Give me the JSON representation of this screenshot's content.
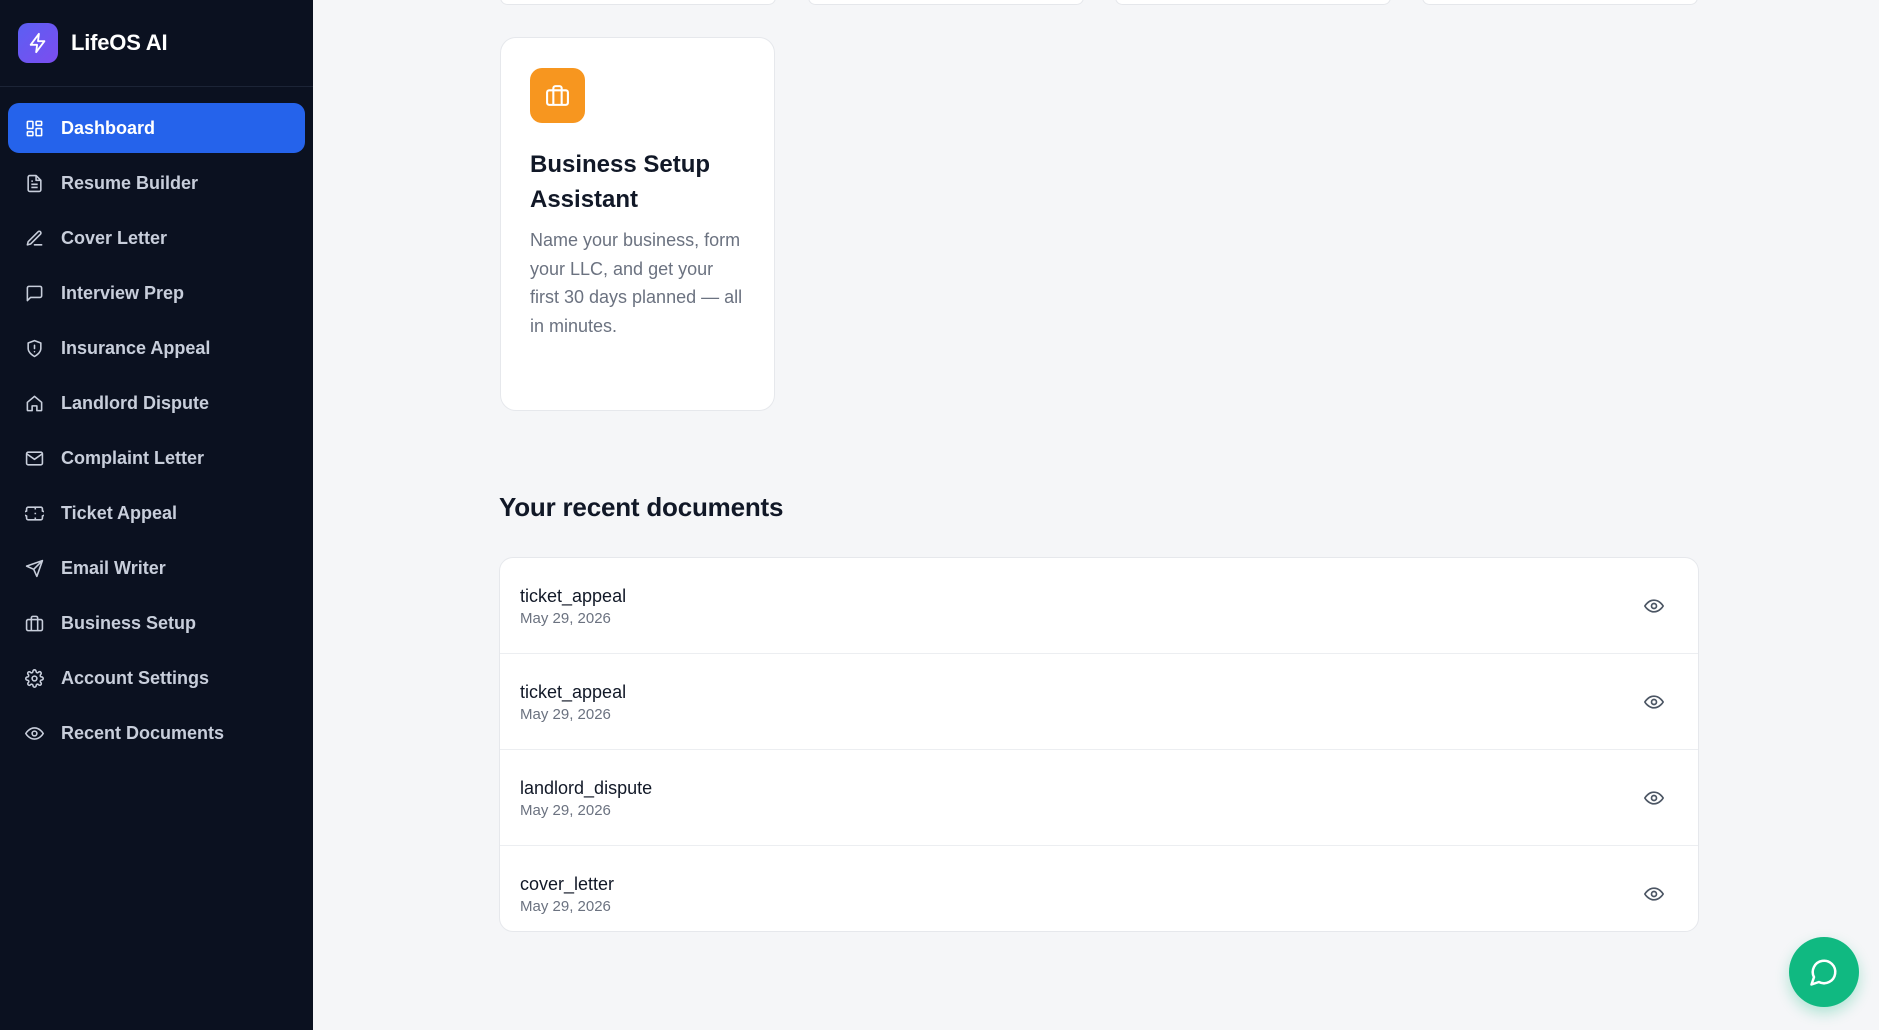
{
  "brand": {
    "name": "LifeOS AI",
    "icon": "lightning-icon",
    "accent": "#6059f2"
  },
  "sidebar": {
    "items": [
      {
        "label": "Dashboard",
        "icon": "dashboard-grid-icon",
        "active": true
      },
      {
        "label": "Resume Builder",
        "icon": "document-icon"
      },
      {
        "label": "Cover Letter",
        "icon": "pen-icon"
      },
      {
        "label": "Interview Prep",
        "icon": "chat-bubble-icon"
      },
      {
        "label": "Insurance Appeal",
        "icon": "shield-icon"
      },
      {
        "label": "Landlord Dispute",
        "icon": "home-icon"
      },
      {
        "label": "Complaint Letter",
        "icon": "mail-icon"
      },
      {
        "label": "Ticket Appeal",
        "icon": "ticket-icon"
      },
      {
        "label": "Email Writer",
        "icon": "send-icon"
      },
      {
        "label": "Business Setup",
        "icon": "briefcase-icon"
      },
      {
        "label": "Account Settings",
        "icon": "gear-icon"
      },
      {
        "label": "Recent Documents",
        "icon": "eye-icon"
      }
    ],
    "active_color": "#2563eb",
    "background": "#0b1120"
  },
  "feature_card": {
    "icon": "briefcase-icon",
    "icon_color": "#f7961f",
    "title": "Business Setup Assistant",
    "description": "Name your business, form your LLC, and get your first 30 days planned — all in minutes."
  },
  "recent_documents": {
    "title": "Your recent documents",
    "items": [
      {
        "name": "ticket_appeal",
        "date": "May 29, 2026"
      },
      {
        "name": "ticket_appeal",
        "date": "May 29, 2026"
      },
      {
        "name": "landlord_dispute",
        "date": "May 29, 2026"
      },
      {
        "name": "cover_letter",
        "date": "May 29, 2026"
      }
    ],
    "action_icon": "eye-icon"
  },
  "chat_button": {
    "icon": "chat-bubble-icon",
    "color": "#10b981"
  }
}
